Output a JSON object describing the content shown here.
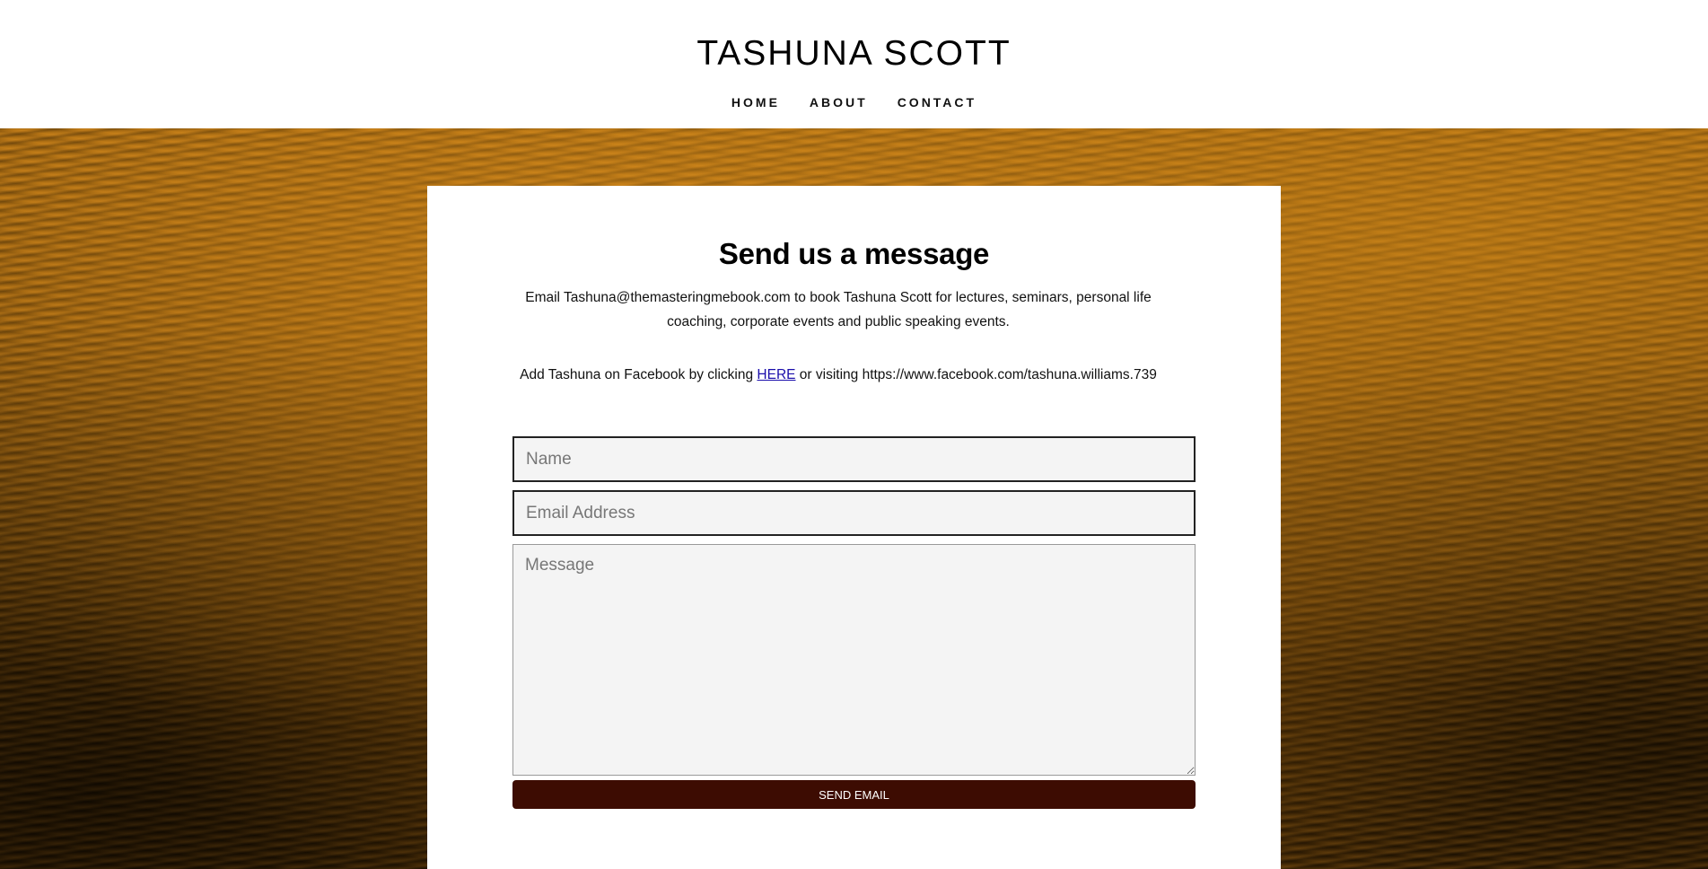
{
  "header": {
    "title": "TASHUNA SCOTT",
    "nav": [
      {
        "label": "HOME"
      },
      {
        "label": "ABOUT"
      },
      {
        "label": "CONTACT"
      }
    ]
  },
  "contact": {
    "heading": "Send us a message",
    "booking_text": "Email Tashuna@themasteringmebook.com to book Tashuna Scott for lectures, seminars, personal life coaching, corporate events and public speaking events.",
    "facebook_prefix": "Add Tashuna on Facebook by clicking ",
    "facebook_link": "HERE",
    "facebook_suffix": " or visiting https://www.facebook.com/tashuna.williams.739",
    "form": {
      "name_placeholder": "Name",
      "email_placeholder": "Email Address",
      "message_placeholder": "Message",
      "submit_label": "SEND EMAIL"
    }
  },
  "colors": {
    "button_bg": "#3d0c02",
    "background_texture": "#a8690f"
  }
}
